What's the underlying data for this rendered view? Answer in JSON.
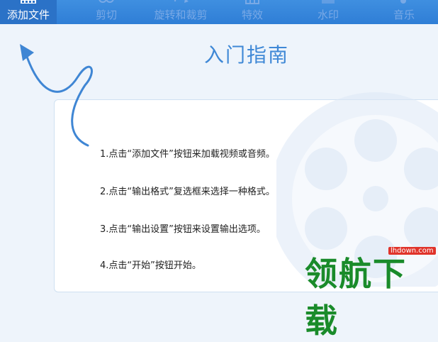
{
  "toolbar": {
    "items": [
      {
        "label": "添加文件",
        "icon": "film-add-icon",
        "active": true
      },
      {
        "label": "剪切",
        "icon": "scissors-icon"
      },
      {
        "label": "旋转和裁剪",
        "icon": "rotate-crop-icon"
      },
      {
        "label": "特效",
        "icon": "effects-icon"
      },
      {
        "label": "水印",
        "icon": "watermark-icon"
      },
      {
        "label": "音乐",
        "icon": "music-icon"
      }
    ]
  },
  "guide": {
    "title": "入门指南",
    "steps": [
      "1.点击“添加文件”按钮来加载视频或音频。",
      "2.点击“输出格式”复选框来选择一种格式。",
      "3.点击“输出设置”按钮来设置输出选项。",
      "4.点击“开始”按钮开始。"
    ]
  },
  "watermark": {
    "text": "领航下载",
    "domain": "lhdown.com"
  },
  "colors": {
    "toolbar": "#3f8fe0",
    "active_tab": "#2b72c7",
    "title": "#3f88d6",
    "arrow": "#3f86d4"
  }
}
